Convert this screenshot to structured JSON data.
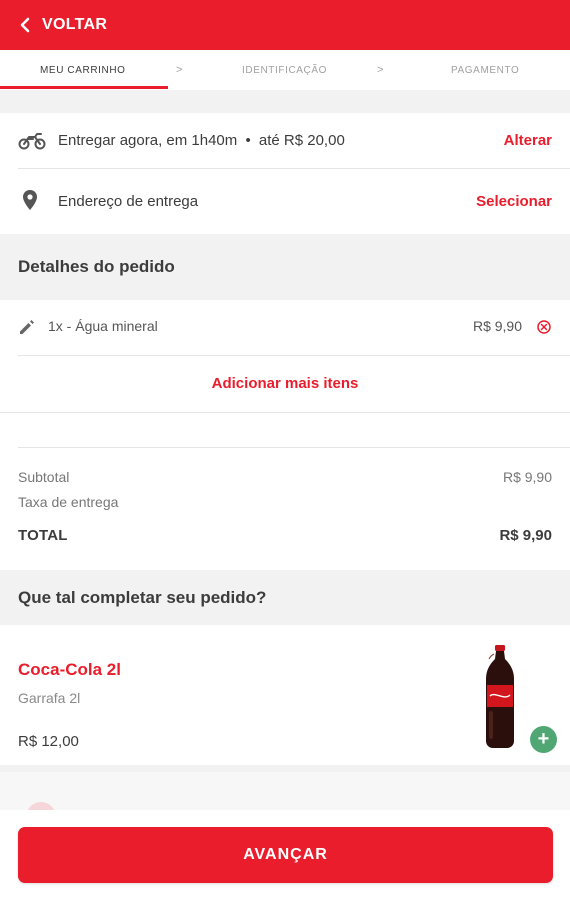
{
  "colors": {
    "brand": "#ea1d2c",
    "add_green": "#50a773"
  },
  "header": {
    "back_label": "VOLTAR"
  },
  "steps": [
    {
      "label": "MEU CARRINHO",
      "active": true
    },
    {
      "label": "IDENTIFICAÇÃO",
      "active": false
    },
    {
      "label": "PAGAMENTO",
      "active": false
    }
  ],
  "step_separator": ">",
  "delivery": {
    "mode_text": "Entregar agora, em 1h40m",
    "bullet": "•",
    "limit_text": "até R$ 20,00",
    "change_label": "Alterar",
    "address_text": "Endereço de entrega",
    "select_label": "Selecionar"
  },
  "order": {
    "section_title": "Detalhes do pedido",
    "items": [
      {
        "text": "1x - Água mineral",
        "price": "R$ 9,90"
      }
    ],
    "add_more_label": "Adicionar mais itens"
  },
  "summary": {
    "subtotal_label": "Subtotal",
    "subtotal_value": "R$ 9,90",
    "fee_label": "Taxa de entrega",
    "total_label": "TOTAL",
    "total_value": "R$ 9,90"
  },
  "suggestions": {
    "section_title": "Que tal completar seu pedido?",
    "products": [
      {
        "name": "Coca-Cola 2l",
        "description": "Garrafa 2l",
        "price": "R$ 12,00",
        "add_symbol": "+"
      }
    ]
  },
  "footer": {
    "cta_label": "AVANÇAR"
  },
  "icons": [
    "chevron-left-icon",
    "motorcycle-icon",
    "location-pin-icon",
    "pencil-icon",
    "remove-circle-icon",
    "plus-icon"
  ]
}
